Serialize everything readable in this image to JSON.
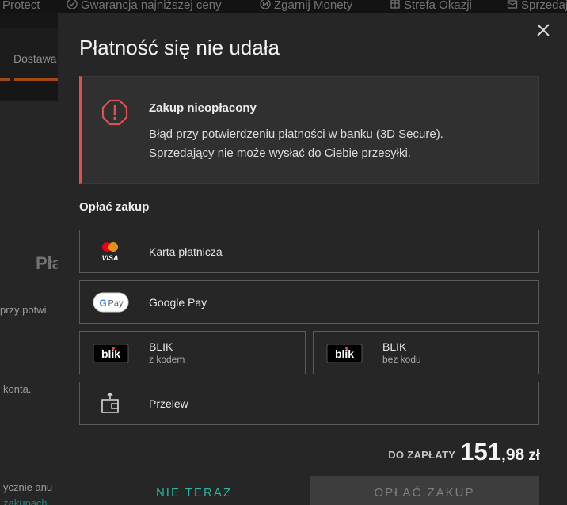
{
  "topbar": {
    "items": [
      {
        "label": "Protect",
        "icon": "shield-icon"
      },
      {
        "label": "Gwarancja najniższej ceny",
        "icon": "price-guarantee-icon"
      },
      {
        "label": "Zgarnij Monety",
        "icon": "coin-icon"
      },
      {
        "label": "Strefa Okazji",
        "icon": "deals-icon"
      },
      {
        "label": "Sprzedaj",
        "icon": "sell-icon"
      }
    ]
  },
  "background": {
    "delivery_label": "Dostawa",
    "title_fragment": "Pła",
    "text_fragment_1": "przy potwi",
    "text_fragment_2": "konta.",
    "text_fragment_3": "ycznie anu",
    "link_fragment": "zakupach"
  },
  "modal": {
    "title": "Płatność się nie udała",
    "close_icon": "close-icon",
    "alert": {
      "icon": "error-octagon-icon",
      "title": "Zakup nieopłacony",
      "message_line1": "Błąd przy potwierdzeniu płatności w banku (3D Secure).",
      "message_line2": "Sprzedający nie może wysłać do Ciebie przesyłki.",
      "accent_color": "#e05050"
    },
    "section_label": "Opłać zakup",
    "payment_options": [
      {
        "label": "Karta płatnicza",
        "logo": "card-logo",
        "logo_text": "VISA"
      },
      {
        "label": "Google Pay",
        "logo": "google-pay-logo",
        "logo_text": "Pay"
      },
      {
        "label": "BLIK",
        "sublabel": "z kodem",
        "logo": "blik-logo",
        "logo_text": "blik"
      },
      {
        "label": "BLIK",
        "sublabel": "bez kodu",
        "logo": "blik-logo",
        "logo_text": "blik"
      },
      {
        "label": "Przelew",
        "logo": "wallet-transfer-icon"
      }
    ],
    "total": {
      "label": "DO ZAPŁATY",
      "amount_int": "151",
      "amount_dec": ",98",
      "currency": "zł"
    },
    "buttons": {
      "later": "NIE TERAZ",
      "pay": "OPŁAĆ ZAKUP"
    }
  }
}
